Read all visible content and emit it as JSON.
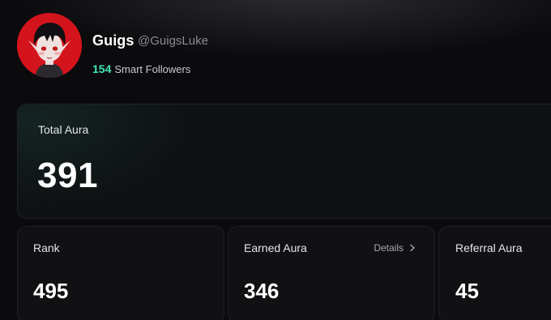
{
  "profile": {
    "name": "Guigs",
    "handle": "@GuigsLuke",
    "smart_followers_count": "154",
    "smart_followers_label": "Smart Followers"
  },
  "total_aura": {
    "label": "Total Aura",
    "value": "391"
  },
  "stats": {
    "rank": {
      "label": "Rank",
      "value": "495"
    },
    "earned": {
      "label": "Earned Aura",
      "value": "346",
      "details_label": "Details"
    },
    "referral": {
      "label": "Referral Aura",
      "value": "45"
    }
  },
  "colors": {
    "accent_green": "#3fe6b5",
    "avatar_bg": "#d4141c",
    "background": "#0b0b0d"
  },
  "icons": {
    "details": "chevron-right-icon"
  }
}
